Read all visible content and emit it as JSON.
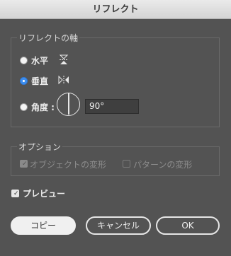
{
  "window": {
    "title": "リフレクト"
  },
  "axis_group": {
    "legend": "リフレクトの軸",
    "horizontal_label": "水平",
    "vertical_label": "垂直",
    "angle_label": "角度 :",
    "angle_value": "90°",
    "selected": "vertical"
  },
  "options_group": {
    "legend": "オプション",
    "transform_objects_label": "オブジェクトの変形",
    "transform_patterns_label": "パターンの変形"
  },
  "preview": {
    "label": "プレビュー",
    "checked": true
  },
  "buttons": {
    "copy": "コピー",
    "cancel": "キャンセル",
    "ok": "OK"
  },
  "colors": {
    "accent": "#3d8ef0",
    "panel": "#535353"
  }
}
